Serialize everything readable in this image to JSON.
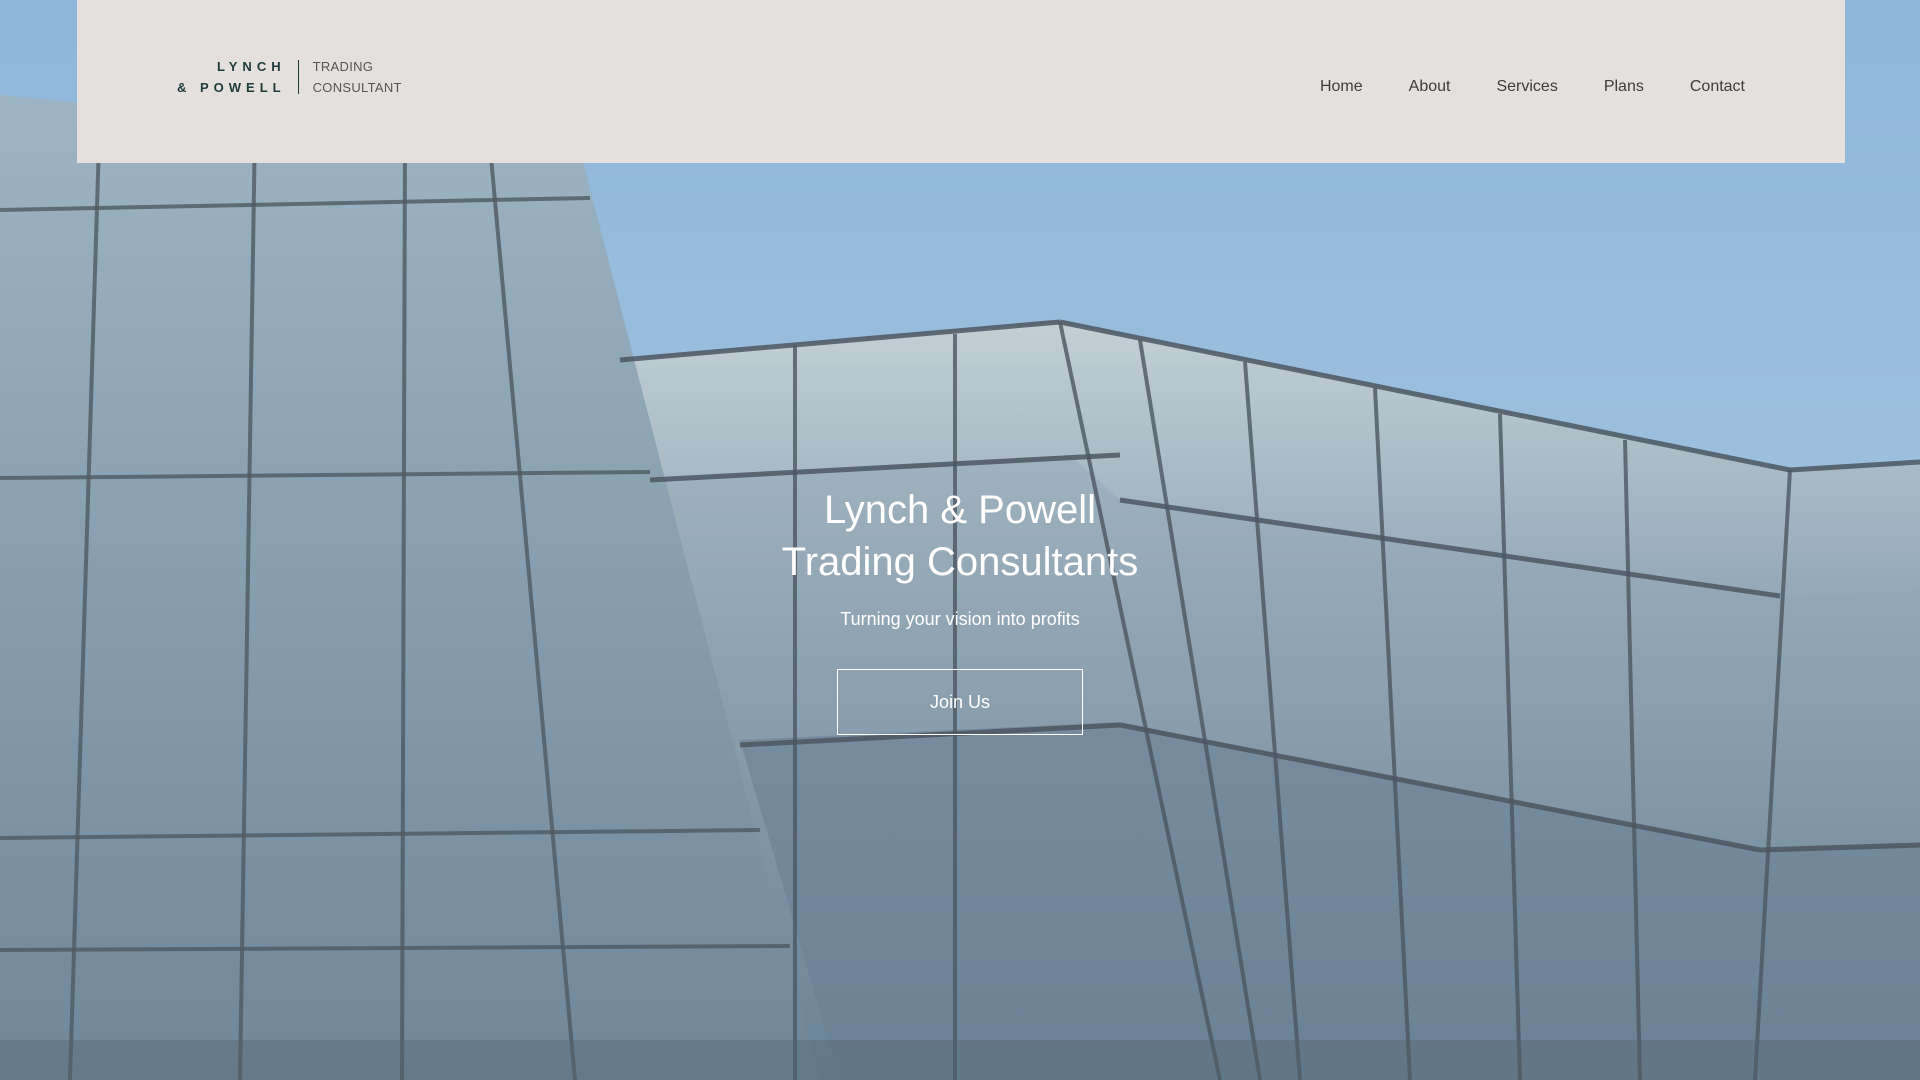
{
  "header": {
    "logo": {
      "line1": "LYNCH",
      "line2": "& POWELL",
      "sub_line1": "TRADING",
      "sub_line2": "CONSULTANT"
    },
    "nav": [
      {
        "label": "Home"
      },
      {
        "label": "About"
      },
      {
        "label": "Services"
      },
      {
        "label": "Plans"
      },
      {
        "label": "Contact"
      }
    ]
  },
  "hero": {
    "title_line1": "Lynch & Powell",
    "title_line2": "Trading Consultants",
    "subtitle": "Turning your vision into profits",
    "cta_label": "Join Us",
    "background": "glass-building-photo"
  },
  "colors": {
    "header_bg": "#e4e0dd",
    "logo_text": "#1f3b3a",
    "nav_text": "#3c3c3c",
    "sky": "#9fc0dd",
    "glass": "#7e98ab",
    "hero_text": "#ffffff"
  }
}
